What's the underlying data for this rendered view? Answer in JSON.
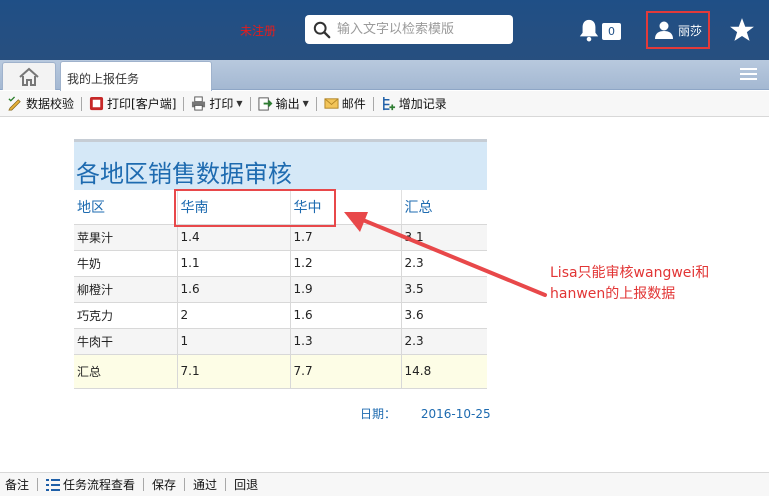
{
  "header": {
    "unregistered": "未注册",
    "search_placeholder": "输入文字以检索模版",
    "notification_count": "0",
    "user_name": "丽莎"
  },
  "tabs": {
    "active_tab": "我的上报任务"
  },
  "toolbar": {
    "items": [
      "数据校验",
      "打印[客户端]",
      "打印",
      "输出",
      "邮件",
      "增加记录"
    ]
  },
  "report": {
    "title": "各地区销售数据审核",
    "columns": [
      "地区",
      "华南",
      "华中",
      "汇总"
    ],
    "rows": [
      [
        "苹果汁",
        "1.4",
        "1.7",
        "3.1"
      ],
      [
        "牛奶",
        "1.1",
        "1.2",
        "2.3"
      ],
      [
        "柳橙汁",
        "1.6",
        "1.9",
        "3.5"
      ],
      [
        "巧克力",
        "2",
        "1.6",
        "3.6"
      ],
      [
        "牛肉干",
        "1",
        "1.3",
        "2.3"
      ]
    ],
    "total_row": [
      "汇总",
      "7.1",
      "7.7",
      "14.8"
    ],
    "date_label": "日期：",
    "date_value": "2016-10-25"
  },
  "annotation": {
    "line1": "Lisa只能审核wangwei和",
    "line2": "hanwen的上报数据"
  },
  "bottom_bar": {
    "items": [
      "备注",
      "任务流程查看",
      "保存",
      "通过",
      "回退"
    ]
  },
  "colors": {
    "header_bg": "#234f83",
    "accent_blue": "#1e6bb0",
    "highlight_red": "#e8484a"
  }
}
